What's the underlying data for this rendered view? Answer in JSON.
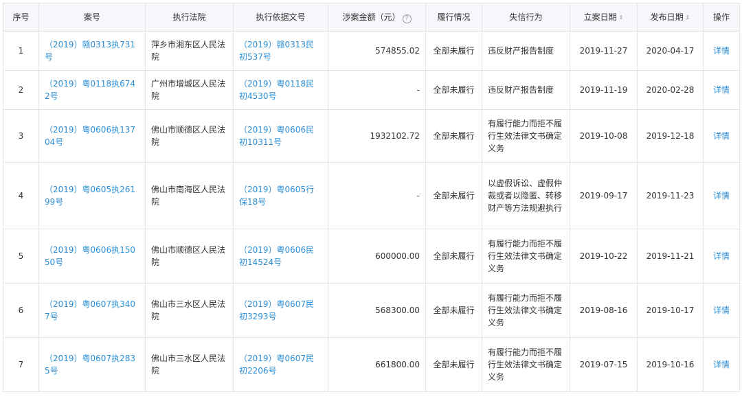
{
  "table": {
    "headers": {
      "index": "序号",
      "case_no": "案号",
      "court": "执行法院",
      "basis": "执行依据文号",
      "amount": "涉案金额（元）",
      "performance": "履行情况",
      "behavior": "失信行为",
      "filing_date": "立案日期",
      "publish_date": "发布日期",
      "action": "操作"
    },
    "amount_info_icon": "?",
    "sort_icon": "⇕",
    "rows": [
      {
        "index": "1",
        "case_no": "（2019）赣0313执731号",
        "court": "萍乡市湘东区人民法院",
        "basis": "（2019）赣0313民初537号",
        "amount": "574855.02",
        "performance": "全部未履行",
        "behavior": "违反财产报告制度",
        "filing_date": "2019-11-27",
        "publish_date": "2020-04-17",
        "action": "详情"
      },
      {
        "index": "2",
        "case_no": "（2019）粤0118执6742号",
        "court": "广州市增城区人民法院",
        "basis": "（2019）粤0118民初4530号",
        "amount": "-",
        "performance": "全部未履行",
        "behavior": "违反财产报告制度",
        "filing_date": "2019-11-19",
        "publish_date": "2020-02-28",
        "action": "详情"
      },
      {
        "index": "3",
        "case_no": "（2019）粤0606执13704号",
        "court": "佛山市顺德区人民法院",
        "basis": "（2019）粤0606民初10311号",
        "amount": "1932102.72",
        "performance": "全部未履行",
        "behavior": "有履行能力而拒不履行生效法律文书确定义务",
        "filing_date": "2019-10-08",
        "publish_date": "2019-12-18",
        "action": "详情"
      },
      {
        "index": "4",
        "case_no": "（2019）粤0605执26199号",
        "court": "佛山市南海区人民法院",
        "basis": "（2019）粤0605行保18号",
        "amount": "-",
        "performance": "全部未履行",
        "behavior": "以虚假诉讼、虚假仲裁或者以隐匿、转移财产等方法规避执行",
        "filing_date": "2019-09-17",
        "publish_date": "2019-11-23",
        "action": "详情"
      },
      {
        "index": "5",
        "case_no": "（2019）粤0606执15050号",
        "court": "佛山市顺德区人民法院",
        "basis": "（2019）粤0606民初14524号",
        "amount": "600000.00",
        "performance": "全部未履行",
        "behavior": "有履行能力而拒不履行生效法律文书确定义务",
        "filing_date": "2019-10-22",
        "publish_date": "2019-11-21",
        "action": "详情"
      },
      {
        "index": "6",
        "case_no": "（2019）粤0607执3407号",
        "court": "佛山市三水区人民法院",
        "basis": "（2019）粤0607民初3293号",
        "amount": "568300.00",
        "performance": "全部未履行",
        "behavior": "有履行能力而拒不履行生效法律文书确定义务",
        "filing_date": "2019-08-16",
        "publish_date": "2019-10-17",
        "action": "详情"
      },
      {
        "index": "7",
        "case_no": "（2019）粤0607执2835号",
        "court": "佛山市三水区人民法院",
        "basis": "（2019）粤0607民初2206号",
        "amount": "661800.00",
        "performance": "全部未履行",
        "behavior": "有履行能力而拒不履行生效法律文书确定义务",
        "filing_date": "2019-07-15",
        "publish_date": "2019-10-16",
        "action": "详情"
      }
    ]
  },
  "colors": {
    "link": "#2c8fd6",
    "header_bg": "#f5f7fa",
    "border": "#e4e4e4",
    "text": "#333333"
  }
}
